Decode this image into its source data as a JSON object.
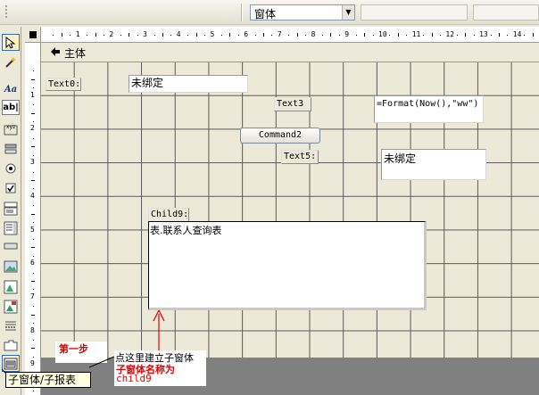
{
  "toolbar": {
    "object_combo_value": "窗体",
    "font_combo_value": "",
    "size_combo_value": ""
  },
  "toolbox": {
    "tools": [
      "select-objects",
      "control-wizards",
      "label",
      "text-box",
      "option-group",
      "toggle-button",
      "option-button",
      "check-box",
      "combo-box",
      "list-box",
      "command-button",
      "image",
      "unbound-object-frame",
      "bound-object-frame",
      "page-break",
      "tab-control",
      "subform-subreport"
    ]
  },
  "ruler": {
    "h_numbers": [
      "1",
      "2",
      "3",
      "4",
      "5",
      "6",
      "7",
      "8",
      "9",
      "10",
      "11",
      "12",
      "13",
      "14"
    ],
    "v_numbers": [
      "1",
      "2",
      "3",
      "4",
      "5",
      "6",
      "7",
      "8",
      "9"
    ]
  },
  "section": {
    "detail_label": "主体"
  },
  "controls": {
    "text0_label": "Text0:",
    "text0_value": "未绑定",
    "text3_label": "Text3",
    "text3_value": "=Format(Now(),\"ww\")",
    "command2_label": "Command2",
    "text5_label": "Text5:",
    "text5_value": "未绑定",
    "child9_label": "Child9:",
    "child9_source": "表.联系人查询表"
  },
  "annotations": {
    "step1": "第一步",
    "click_here": "点这里建立子窗体",
    "subform_name_line1": "子窗体名称为",
    "subform_name_line2": "child9",
    "tooltip": "子窗体/子报表"
  },
  "colors": {
    "annotation_red": "#e00000",
    "grid_background": "#ece9d8",
    "grid_lines": "#5a5a5a",
    "form_footer": "#808080"
  }
}
